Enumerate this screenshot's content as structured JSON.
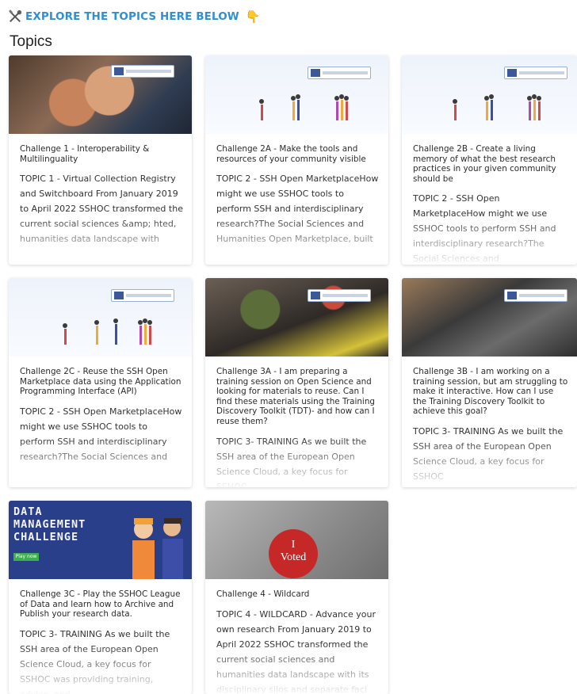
{
  "header": {
    "explore_label": "EXPLORE THE TOPICS HERE BELOW",
    "icons": [
      "tools-icon",
      "pointing-down-hand-icon"
    ],
    "accent_color": "#2f8fd6"
  },
  "section": {
    "title": "Topics"
  },
  "cards": [
    {
      "challenge": "Challenge 1 - Interoperability & Multilinguality",
      "description": "TOPIC 1 - Virtual Collection Registry and Switchboard From January 2019 to April 2022 SSHOC transformed the current social sciences &amp; hted, humanities data landscape with"
    },
    {
      "challenge": "Challenge 2A - Make the tools and resources of your community visible",
      "description": "TOPIC 2 - SSH Open MarketplaceHow might we use SSHOC tools to perform SSH and interdisciplinary research?The Social Sciences and Humanities Open Marketplace, built"
    },
    {
      "challenge": "Challenge 2B - Create a living memory of what the best research practices in your given community should be",
      "description": "TOPIC 2 - SSH Open MarketplaceHow might we use SSHOC tools to perform SSH and interdisciplinary research?The Social Sciences and"
    },
    {
      "challenge": "Challenge 2C - Reuse the SSH Open Marketplace data using the Application Programming Interface (API)",
      "description": "TOPIC 2 - SSH Open MarketplaceHow might we use SSHOC tools to perform SSH and interdisciplinary research?The Social Sciences and"
    },
    {
      "challenge": "Challenge 3A - I am preparing a training session on Open Science and looking for materials to reuse. Can I find these materials using the Training Discovery Toolkit (TDT)- and how can I reuse them?",
      "description": "TOPIC 3- TRAINING As we built the SSH area of the European Open Science Cloud, a key focus for SSHOC"
    },
    {
      "challenge": "Challenge 3B - I am working on a training session, but am struggling to make it interactive. How can I use the Training Discovery Toolkit to achieve this goal?",
      "description": "TOPIC 3- TRAINING As we built the SSH area of the European Open Science Cloud, a key focus for SSHOC"
    },
    {
      "challenge": "Challenge 3C - Play the SSHOC League of Data and learn how to Archive and Publish your research data.",
      "description": "TOPIC 3- TRAINING As we built the SSH area of the European Open Science Cloud, a key focus for SSHOC was providing training, advice, and"
    },
    {
      "challenge": "Challenge 4 - Wildcard",
      "description": "TOPIC 4 - WILDCARD - Advance your own research From January 2019 to April 2022 SSHOC transformed the current social sciences and humanities data landscape with its disciplinary silos and separate faci"
    }
  ],
  "image_text": {
    "data_challenge": [
      "DATA",
      "MANAGEMENT",
      "CHALLENGE"
    ],
    "data_button": "Play now",
    "voted": [
      "I",
      "Voted"
    ]
  }
}
